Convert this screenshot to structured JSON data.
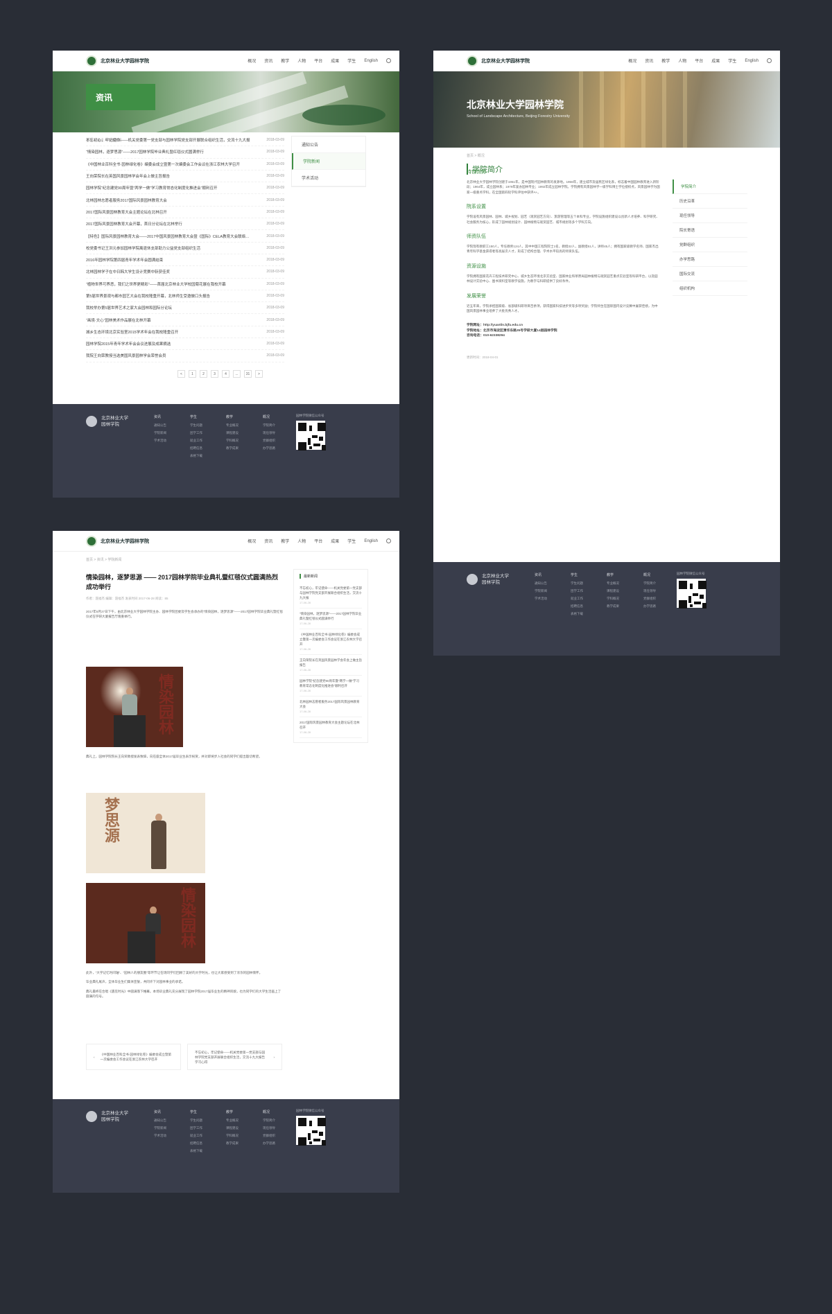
{
  "brand": {
    "name": "北京林业大学园林学院"
  },
  "nav": {
    "items": [
      "概况",
      "资讯",
      "教学",
      "人物",
      "平台",
      "成果",
      "学生",
      "English"
    ]
  },
  "footer": {
    "name_line1": "北京林业大学",
    "name_line2": "园林学院",
    "cols": [
      {
        "title": "资讯",
        "items": [
          "通知公告",
          "学院新闻",
          "学术活动"
        ]
      },
      {
        "title": "学生",
        "items": [
          "学生问题",
          "团学工作",
          "就业工作",
          "招聘信息",
          "表格下载"
        ]
      },
      {
        "title": "教学",
        "items": [
          "专业概况",
          "课程建设",
          "学科概况",
          "教学成果"
        ]
      },
      {
        "title": "概况",
        "items": [
          "学院简介",
          "现任领导",
          "党群组织",
          "办学思路"
        ]
      }
    ],
    "qr_label": "园林学院微信公众号"
  },
  "page1": {
    "tag": "资讯",
    "crumb": "首页 > 资讯 > 学院新闻",
    "news": [
      {
        "t": "不忘初心，牢记使命——机关党委第一党支部与园林学院党支部开展联合组织生活，交流十九大报",
        "d": "2018-03-09"
      },
      {
        "t": "“情染园林，逐梦思源”——2017园林学院毕业典礼暨红毯仪式圆满举行",
        "d": "2018-03-09"
      },
      {
        "t": "《中国林业百科全书·园林绿化卷》编委会成立暨第一次编委会工作会议在浙江农林大学召开",
        "d": "2018-03-09"
      },
      {
        "t": "王向荣院长在英国风景园林学会年会上做主旨报告",
        "d": "2018-03-09"
      },
      {
        "t": "园林学院“纪念建党90周年暨”两学一做”学习教育常态化制度化推进会”顺利召开",
        "d": "2018-03-09"
      },
      {
        "t": "北林园林志愿者服务2017国际风景园林教育大会",
        "d": "2018-03-09"
      },
      {
        "t": "2017国际风景园林教育大会主题论坛在北林召开",
        "d": "2018-03-09"
      },
      {
        "t": "2017国际风景园林教育大会开幕，首日分论坛在北林举行",
        "d": "2018-03-09"
      },
      {
        "t": "【特色】国际风景园林教育大会——2017中国风景园林教育大会暨《国际》CELA教育大会联络召开",
        "d": "2018-03-09"
      },
      {
        "t": "校党委书记王洪元参加园林学院离退休支部助力公益党支部组织生活",
        "d": "2018-03-09"
      },
      {
        "t": "2016年园林学院第四届青年学术年会圆满结束",
        "d": "2018-03-09"
      },
      {
        "t": "北林园林学子在中日韩大学生设计竞赛中斩获佳奖",
        "d": "2018-03-09"
      },
      {
        "t": "“植物世界可界恶，我们之世界更精彩”——首届北京林业大学校园菊花展在我校开幕",
        "d": "2018-03-09"
      },
      {
        "t": "第5届世界景观与都市园艺大会在我校隆重开幕，北林师生受邀做口头报告",
        "d": "2018-03-09"
      },
      {
        "t": "我校举办第5届世界艺术之家大会园林和园际分论坛",
        "d": "2018-03-09"
      },
      {
        "t": "“画境·文心”园林美术作品展在北林开幕",
        "d": "2018-03-09"
      },
      {
        "t": "城乡生态环境北京实验室2015学术年会在我校隆重召开",
        "d": "2018-03-09"
      },
      {
        "t": "园林学院2015年青年学术年会会议进展及成果摘选",
        "d": "2018-03-09"
      },
      {
        "t": "我院王向荣教授当选美国风景园林学会荣誉会员",
        "d": "2018-03-09"
      }
    ],
    "side": [
      "通知公告",
      "学院新闻",
      "学术活动"
    ],
    "pager": [
      "<",
      "1",
      "2",
      "3",
      "4",
      "...",
      "31",
      ">"
    ]
  },
  "page2": {
    "title": "北京林业大学园林学院",
    "subtitle": "School of Landscape Architecture, Beijing Forestry University",
    "crumb": "首页 > 概况",
    "section": "学院简介",
    "blocks": [
      {
        "h": "特色优势",
        "p": "北京林业大学园林学院创建于1951年，是中国现代园林教育的发源地。1956年，建立城市及居民区绿化系，标志着中国园林教育进入新阶段；1964年，成立园林系；1979年复办园林专业；1992年成立园林学院。学院拥有风景园林学一级学科博士学位授权点，风景园林学为国家一级重点学科，在全国第四轮学科评估中获评A+。"
      },
      {
        "h": "院系设置",
        "p": "学院设有风景园林、园林、城乡规划、园艺（观赏园艺方向）、旅游管理等五个本科专业，学院设施组织建设以创新人才培养、科学研究、社会服务为核心，形成了园林规划设计、园林植物与观赏园艺、城市规划等多个学科方向。"
      },
      {
        "h": "师资队伍",
        "p": "学院现有教职工150人，专任教师124人，其中中国工程院院士1名，教授32人，副教授51人，讲师45人；拥有国家级教学名师、国家杰出青年科学基金获得者等高层次人才，形成了结构合理、学术水平较高的师资队伍。"
      },
      {
        "h": "资源设施",
        "p": "学院拥有国家花卉工程技术研究中心、城乡生态环境北京实验室、国家林业和草原局园林植物与观赏园艺重点实验室等科研平台，以及园林设计实验中心、图书资料室等教学设施，为教学与科研提供了良好条件。"
      },
      {
        "h": "发展荣誉",
        "p": "近五年来，学院承担国家级、省部级科研项目百余项，获得国家科技进步奖等多项奖励；学院师生在国际国内设计竞赛中屡获佳绩，为中国风景园林事业培养了大批优秀人才。"
      }
    ],
    "contact": {
      "web": "学院网址：http://yuanlin.bjfu.edu.cn",
      "addr": "学院地址：北京市海淀区清华东路35号学研大厦14层园林学院",
      "tel": "咨询电话：010-62338294"
    },
    "updated": "更新时间：2018-04-01",
    "side": [
      "学院简介",
      "历史沿革",
      "现任领导",
      "院长寄语",
      "党群组织",
      "办学思路",
      "国际交流",
      "组织机构"
    ]
  },
  "page3": {
    "crumb": "首页 > 资讯 > 学院新闻",
    "title": "情染园林，逐梦思源 —— 2017园林学院毕业典礼暨红毯仪式圆满热烈成功举行",
    "meta": "作者：聂福杰   编辑：聂福杰   发表时间 2017-06-28   阅读：85",
    "p1": "2017年6月27日下午，由北京林业大学园林学院主办、园林学院团委及学生会承办的“情染园林，逐梦思源”——2017园林学院毕业典礼暨红毯仪式在学研大厦报告厅隆重举行。",
    "p2": "典礼上，园林学院院长王向荣教授发表致辞，向在座全体2017届毕业生表示祝贺，并对即将步入社会的同学们提出殷切希望。",
    "p3": "此外，“大学记忆时间轴”、“园林人的朋友圈”等环节让在场同学们回顾了美好的大学时光，也让大家感受到了浓浓的园林情怀。",
    "p4": "毕业典礼尾声，全体毕业生们集体宣誓，共同许下对园林事业的承诺。",
    "p5": "典礼最终在合唱《遇见时光》中圆满落下帷幕。本场毕业典礼充分展现了园林学院2017届毕业生的精神风貌，也为同学们的大学生活画上了圆满的句号。",
    "prev": "《中国林业百科全书·园林绿化卷》编委会成立暨第一次编委会工作会议在浙江农林大学召开",
    "next": "不忘初心，牢记使命——机关党委第一党支部与园林学院党支部开展联合组织生活，交流十九大报告学习心得",
    "side_title": "最新新闻",
    "side": [
      {
        "t": "不忘初心，牢记使命——机关党委第一党支部与园林学院党支部开展联合组织生活，交流十九大报",
        "d": "17-06-28"
      },
      {
        "t": "“情染园林，逐梦思源”——2017园林学院毕业典礼暨红毯仪式圆满举行",
        "d": "17-06-28"
      },
      {
        "t": "《中国林业百科全书·园林绿化卷》编委会成立暨第一次编委会工作会议在浙江农林大学召开",
        "d": "17-06-28"
      },
      {
        "t": "王向荣院长在英国风景园林学会年会上做主旨报告",
        "d": "17-06-28"
      },
      {
        "t": "园林学院“纪念建党90周年暨”两学一做”学习教育常态化制度化推进会”顺利召开",
        "d": "17-06-28"
      },
      {
        "t": "北林园林志愿者服务2017国际风景园林教育大会",
        "d": "17-06-28"
      },
      {
        "t": "2017国际风景园林教育大会主题论坛在北林召开",
        "d": "17-06-28"
      }
    ]
  }
}
